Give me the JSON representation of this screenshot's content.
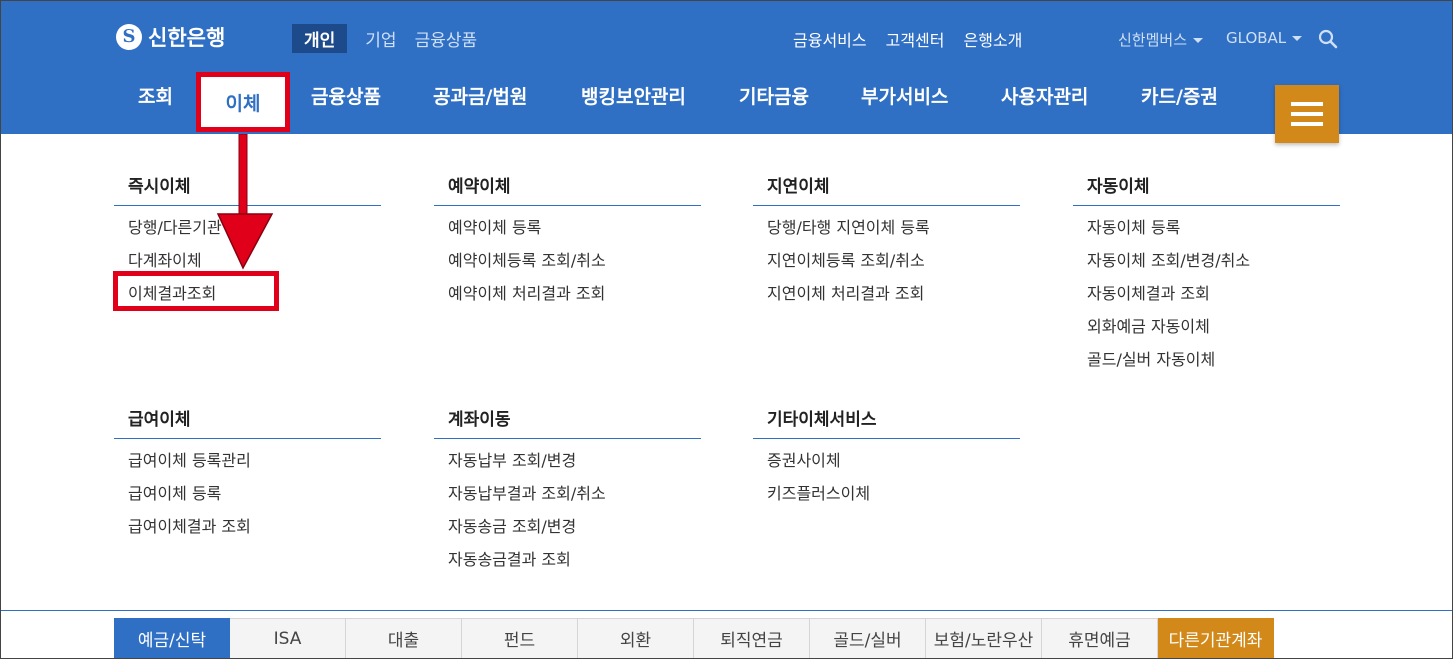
{
  "header": {
    "logo_text": "신한은행",
    "segments": [
      "개인",
      "기업",
      "금융상품"
    ],
    "util_links": [
      "금융서비스",
      "고객센터",
      "은행소개"
    ],
    "member_label": "신한멤버스",
    "global_label": "GLOBAL"
  },
  "gnb": [
    "조회",
    "이체",
    "금융상품",
    "공과금/법원",
    "뱅킹보안관리",
    "기타금융",
    "부가서비스",
    "사용자관리",
    "카드/증권"
  ],
  "menu": {
    "instant": {
      "title": "즉시이체",
      "items": [
        "당행/다른기관",
        "다계좌이체",
        "이체결과조회"
      ]
    },
    "reserved": {
      "title": "예약이체",
      "items": [
        "예약이체 등록",
        "예약이체등록 조회/취소",
        "예약이체 처리결과 조회"
      ]
    },
    "delayed": {
      "title": "지연이체",
      "items": [
        "당행/타행 지연이체 등록",
        "지연이체등록 조회/취소",
        "지연이체 처리결과 조회"
      ]
    },
    "auto": {
      "title": "자동이체",
      "items": [
        "자동이체 등록",
        "자동이체 조회/변경/취소",
        "자동이체결과 조회",
        "외화예금 자동이체",
        "골드/실버 자동이체"
      ]
    },
    "salary": {
      "title": "급여이체",
      "items": [
        "급여이체 등록관리",
        "급여이체 등록",
        "급여이체결과 조회"
      ]
    },
    "move": {
      "title": "계좌이동",
      "items": [
        "자동납부 조회/변경",
        "자동납부결과 조회/취소",
        "자동송금 조회/변경",
        "자동송금결과 조회"
      ]
    },
    "etc": {
      "title": "기타이체서비스",
      "items": [
        "증권사이체",
        "키즈플러스이체"
      ]
    }
  },
  "bottom_tabs": [
    "예금/신탁",
    "ISA",
    "대출",
    "펀드",
    "외환",
    "퇴직연금",
    "골드/실버",
    "보험/노란우산",
    "휴면예금",
    "다른기관계좌"
  ],
  "colors": {
    "brand_blue": "#2f6fc4",
    "accent_orange": "#d2891a",
    "highlight_red": "#e0001a"
  }
}
